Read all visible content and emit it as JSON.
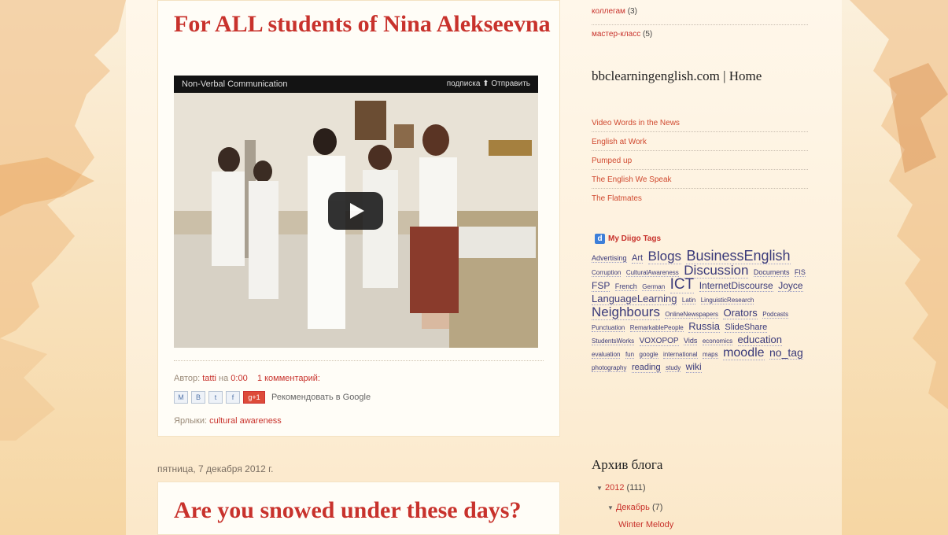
{
  "posts": [
    {
      "title": "For ALL students of Nina Alekseevna",
      "video": {
        "title": "Non-Verbal Communication",
        "controls_text": "подписка  ⬆ Отправить"
      },
      "meta": {
        "author_prefix": "Автор:",
        "author": "tatti",
        "time_prefix": "на",
        "time": "0:00",
        "comments": "1 комментарий:"
      },
      "share": {
        "buttons": [
          "M",
          "B",
          "t",
          "f",
          "g+1"
        ],
        "recommend_text": "Рекомендовать в Google"
      },
      "labels_prefix": "Ярлыки:",
      "labels": "cultural awareness"
    },
    {
      "date": "пятница, 7 декабря 2012 г.",
      "title": "Are you snowed under these days?"
    }
  ],
  "sidebar": {
    "top_links": [
      {
        "label": "коллегам",
        "count": "(3)"
      },
      {
        "label": "мастер-класс",
        "count": "(5)"
      }
    ],
    "bbc": {
      "title": "bbclearningenglish.com | Home",
      "links": [
        "Video Words in the News",
        "English at Work",
        "Pumped up",
        "The English We Speak",
        "The Flatmates"
      ]
    },
    "diigo": {
      "logo": "d",
      "title": "My Diigo Tags",
      "tags": [
        {
          "t": "Advertising",
          "s": 9
        },
        {
          "t": "Art",
          "s": 11
        },
        {
          "t": "Blogs",
          "s": 17
        },
        {
          "t": "BusinessEnglish",
          "s": 18
        },
        {
          "t": "Corruption",
          "s": 8
        },
        {
          "t": "CulturalAwareness",
          "s": 8
        },
        {
          "t": "Discussion",
          "s": 17
        },
        {
          "t": "Documents",
          "s": 9
        },
        {
          "t": "FIS",
          "s": 9
        },
        {
          "t": "FSP",
          "s": 12
        },
        {
          "t": "French",
          "s": 9
        },
        {
          "t": "German",
          "s": 8
        },
        {
          "t": "ICT",
          "s": 19
        },
        {
          "t": "InternetDiscourse",
          "s": 12
        },
        {
          "t": "Joyce",
          "s": 12
        },
        {
          "t": "LanguageLearning",
          "s": 13
        },
        {
          "t": "Latin",
          "s": 8
        },
        {
          "t": "LinguisticResearch",
          "s": 8
        },
        {
          "t": "Neighbours",
          "s": 17
        },
        {
          "t": "OnlineNewspapers",
          "s": 8
        },
        {
          "t": "Orators",
          "s": 13
        },
        {
          "t": "Podcasts",
          "s": 8
        },
        {
          "t": "Punctuation",
          "s": 8
        },
        {
          "t": "RemarkablePeople",
          "s": 8
        },
        {
          "t": "Russia",
          "s": 13
        },
        {
          "t": "SlideShare",
          "s": 11
        },
        {
          "t": "StudentsWorks",
          "s": 8
        },
        {
          "t": "VOXOPOP",
          "s": 10
        },
        {
          "t": "Vids",
          "s": 9
        },
        {
          "t": "economics",
          "s": 8
        },
        {
          "t": "education",
          "s": 13
        },
        {
          "t": "evaluation",
          "s": 8
        },
        {
          "t": "fun",
          "s": 8
        },
        {
          "t": "google",
          "s": 8
        },
        {
          "t": "international",
          "s": 8
        },
        {
          "t": "maps",
          "s": 8
        },
        {
          "t": "moodle",
          "s": 16
        },
        {
          "t": "no_tag",
          "s": 14
        },
        {
          "t": "photography",
          "s": 8
        },
        {
          "t": "reading",
          "s": 11
        },
        {
          "t": "study",
          "s": 8
        },
        {
          "t": "wiki",
          "s": 12
        }
      ]
    },
    "archive": {
      "title": "Архив блога",
      "year": "2012",
      "year_count": "(111)",
      "month": "Декабрь",
      "month_count": "(7)",
      "post": "Winter Melody"
    }
  },
  "colors": {
    "title_red": "#c8322c",
    "link_red": "#d04a30",
    "tag_blue": "#3a3a7a",
    "background_peach": "#f8e1bb"
  }
}
